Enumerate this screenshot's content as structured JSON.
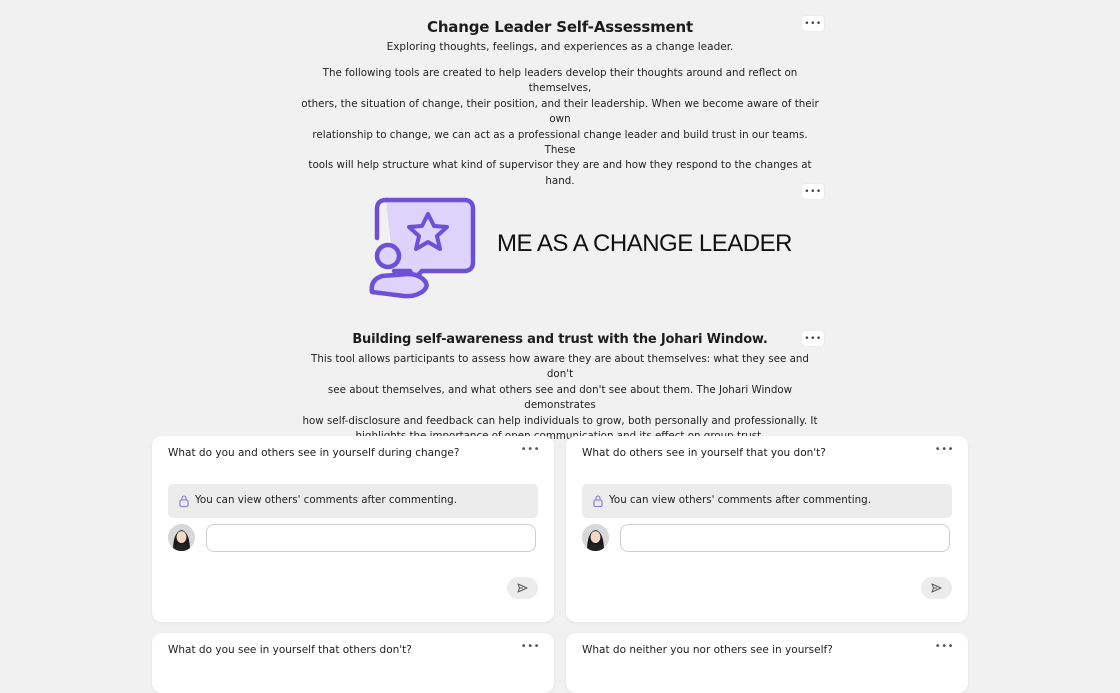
{
  "header": {
    "title": "Change Leader Self-Assessment",
    "subtitle": "Exploring thoughts, feelings, and experiences as a change leader.",
    "intro_lines": [
      "The following tools are created to help leaders develop their thoughts around and reflect on themselves,",
      "others, the situation of change, their position, and their leadership. When we become aware of their own",
      "relationship to change, we can act as a professional change leader and build trust in our teams. These",
      "tools will help structure what kind of supervisor they are and how they respond to the changes at hand."
    ],
    "more_label": "•••"
  },
  "banner": {
    "text": "ME AS A CHANGE LEADER",
    "icon": "person-star-chat-icon",
    "accent_color": "#6e4fd8",
    "fill_color": "#ddd3fb",
    "more_label": "•••"
  },
  "johari": {
    "title": "Building self-awareness and trust with the Johari Window.",
    "description_lines": [
      "This tool allows participants to assess how aware they are about themselves: what they see and don't",
      "see about themselves, and what others see and don't see about them. The Johari Window demonstrates",
      "how self-disclosure and feedback can help individuals to grow, both personally and professionally. It",
      "highlights the importance of open communication and its effect on group trust."
    ],
    "more_label": "•••"
  },
  "cards": [
    {
      "question": "What do you and others see in yourself during change?",
      "notice": "You can view others' comments after commenting.",
      "input_value": "",
      "input_placeholder": "",
      "more_label": "•••"
    },
    {
      "question": "What do others see in yourself that you don't?",
      "notice": "You can view others' comments after commenting.",
      "input_value": "",
      "input_placeholder": "",
      "more_label": "•••"
    },
    {
      "question": "What do you see in yourself that others don't?",
      "more_label": "•••"
    },
    {
      "question": "What do neither you nor others see in yourself?",
      "more_label": "•••"
    }
  ]
}
